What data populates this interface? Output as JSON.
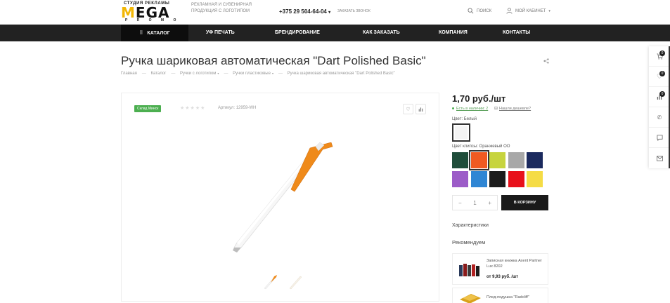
{
  "header": {
    "logo": {
      "top": "СТУДИЯ РЕКЛАМЫ",
      "main_m": "M",
      "main_rest": "EGA",
      "bottom": "P R O M O"
    },
    "tagline": "РЕКЛАМНАЯ И СУВЕНИРНАЯ ПРОДУКЦИЯ С ЛОГОТИПОМ",
    "phone": "+375 29 504-64-04",
    "callback": "Заказать звонок",
    "search": "Поиск",
    "cabinet": "Мой кабинет"
  },
  "nav": {
    "catalog": "Каталог",
    "items": [
      "УФ печать",
      "Брендирование",
      "Как заказать",
      "Компания",
      "Контакты"
    ]
  },
  "page": {
    "title": "Ручка шариковая автоматическая \"Dart Polished Basic\"",
    "breadcrumbs": [
      "Главная",
      "Каталог",
      "Ручки с логотипом",
      "Ручки пластиковые",
      "Ручка шариковая автоматическая \"Dart Polished Basic\""
    ]
  },
  "product": {
    "badge": "Склад Минск",
    "stars": "★★★★★",
    "article": "Артикул: 12959-WH",
    "price": "1,70 руб./шт",
    "stock": "Есть в наличии: 2",
    "cheaper": "Нашли дешевле?",
    "color_label": "Цвет: Белый",
    "clip_label": "Цвет клипсы: Оранжевый OO",
    "clip_colors": [
      "#1f4d3a",
      "#f05a22",
      "#c7d43e",
      "#a8a8a8",
      "#1b2a5e",
      "#9c5cc8",
      "#2f86d4",
      "#1c1c1c",
      "#e8101a",
      "#f5dc45"
    ],
    "qty": "1",
    "qty_minus": "−",
    "qty_plus": "+",
    "cart": "В корзину",
    "specs": "Характеристики",
    "recommend": "Рекомендуем"
  },
  "recommendations": [
    {
      "name": "Записная книжка Axent Partner Lux 8202",
      "price": "от 9,93 руб. /шт"
    },
    {
      "name": "Плед-подушка \"Radcliff\"",
      "price": ""
    }
  ],
  "sidebar": {
    "cart_count": "0",
    "fav_count": "0",
    "compare_count": "0"
  },
  "colors": {
    "accent": "#f2b705",
    "nav_bg": "#222222",
    "stock_green": "#4caf50"
  }
}
